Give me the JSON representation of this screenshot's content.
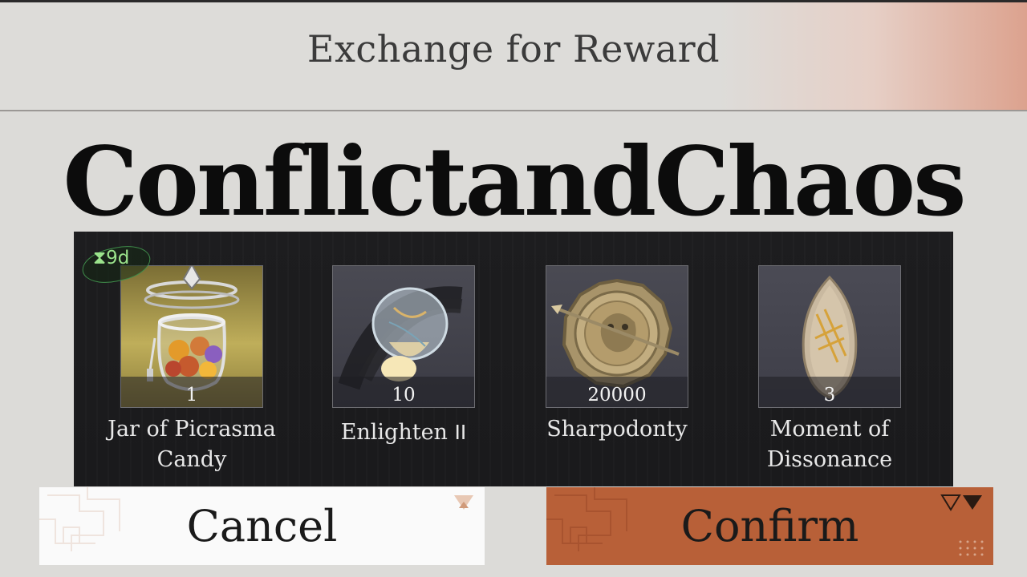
{
  "header": {
    "title": "Exchange for Reward"
  },
  "overlay": {
    "text": "ConflictandChaos"
  },
  "timer": {
    "icon": "hourglass-icon",
    "text": "9d",
    "color": "#9be38c"
  },
  "items": [
    {
      "name_line1": "Jar of Picrasma",
      "name_line2": "Candy",
      "count": "1",
      "icon": "candy-jar-icon"
    },
    {
      "name_line1": "Enlighten",
      "name_line2": "",
      "suffix": "II",
      "count": "10",
      "icon": "enlighten-bulb-icon"
    },
    {
      "name_line1": "Sharpodonty",
      "name_line2": "",
      "count": "20000",
      "icon": "sharpodonty-coin-icon"
    },
    {
      "name_line1": "Moment of",
      "name_line2": "Dissonance",
      "count": "3",
      "icon": "dissonance-seed-icon"
    }
  ],
  "buttons": {
    "cancel_label": "Cancel",
    "confirm_label": "Confirm"
  },
  "colors": {
    "confirm_bg": "#b86038",
    "cancel_bg": "#fafafa",
    "panel_bg": "#1d1d1f",
    "accent_green": "#3f8c4a"
  }
}
